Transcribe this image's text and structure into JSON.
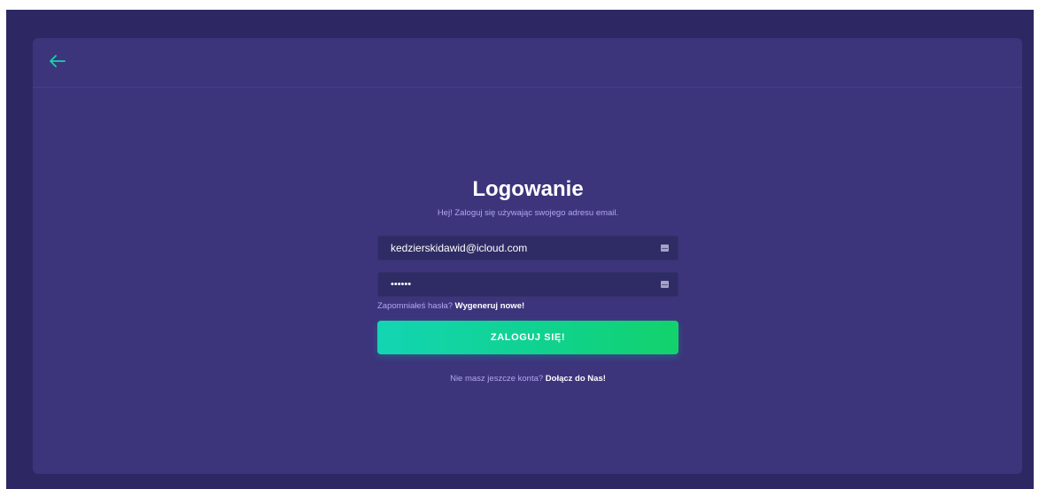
{
  "header": {
    "back_icon": "arrow-left-icon",
    "back_glyph": "←",
    "accent_color": "#17d4a8"
  },
  "login": {
    "title": "Logowanie",
    "subtitle": "Hej! Zaloguj się używając swojego adresu email.",
    "email": {
      "value": "kedzierskidawid@icloud.com",
      "icon": "card-icon"
    },
    "password": {
      "value": "••••••",
      "icon": "card-icon"
    },
    "forgot": {
      "text": "Zapomniałeś hasła?",
      "link": "Wygeneruj nowe!"
    },
    "submit_label": "ZALOGUJ SIĘ!",
    "register": {
      "text": "Nie masz jeszcze konta?",
      "link": "Dołącz do Nas!"
    }
  },
  "colors": {
    "page_background": "#2d2863",
    "card_background": "#3c357c",
    "input_background": "#2f2b65",
    "button_gradient_start": "#13d5b2",
    "button_gradient_end": "#12d26c",
    "muted_text": "#b2a6ef"
  }
}
